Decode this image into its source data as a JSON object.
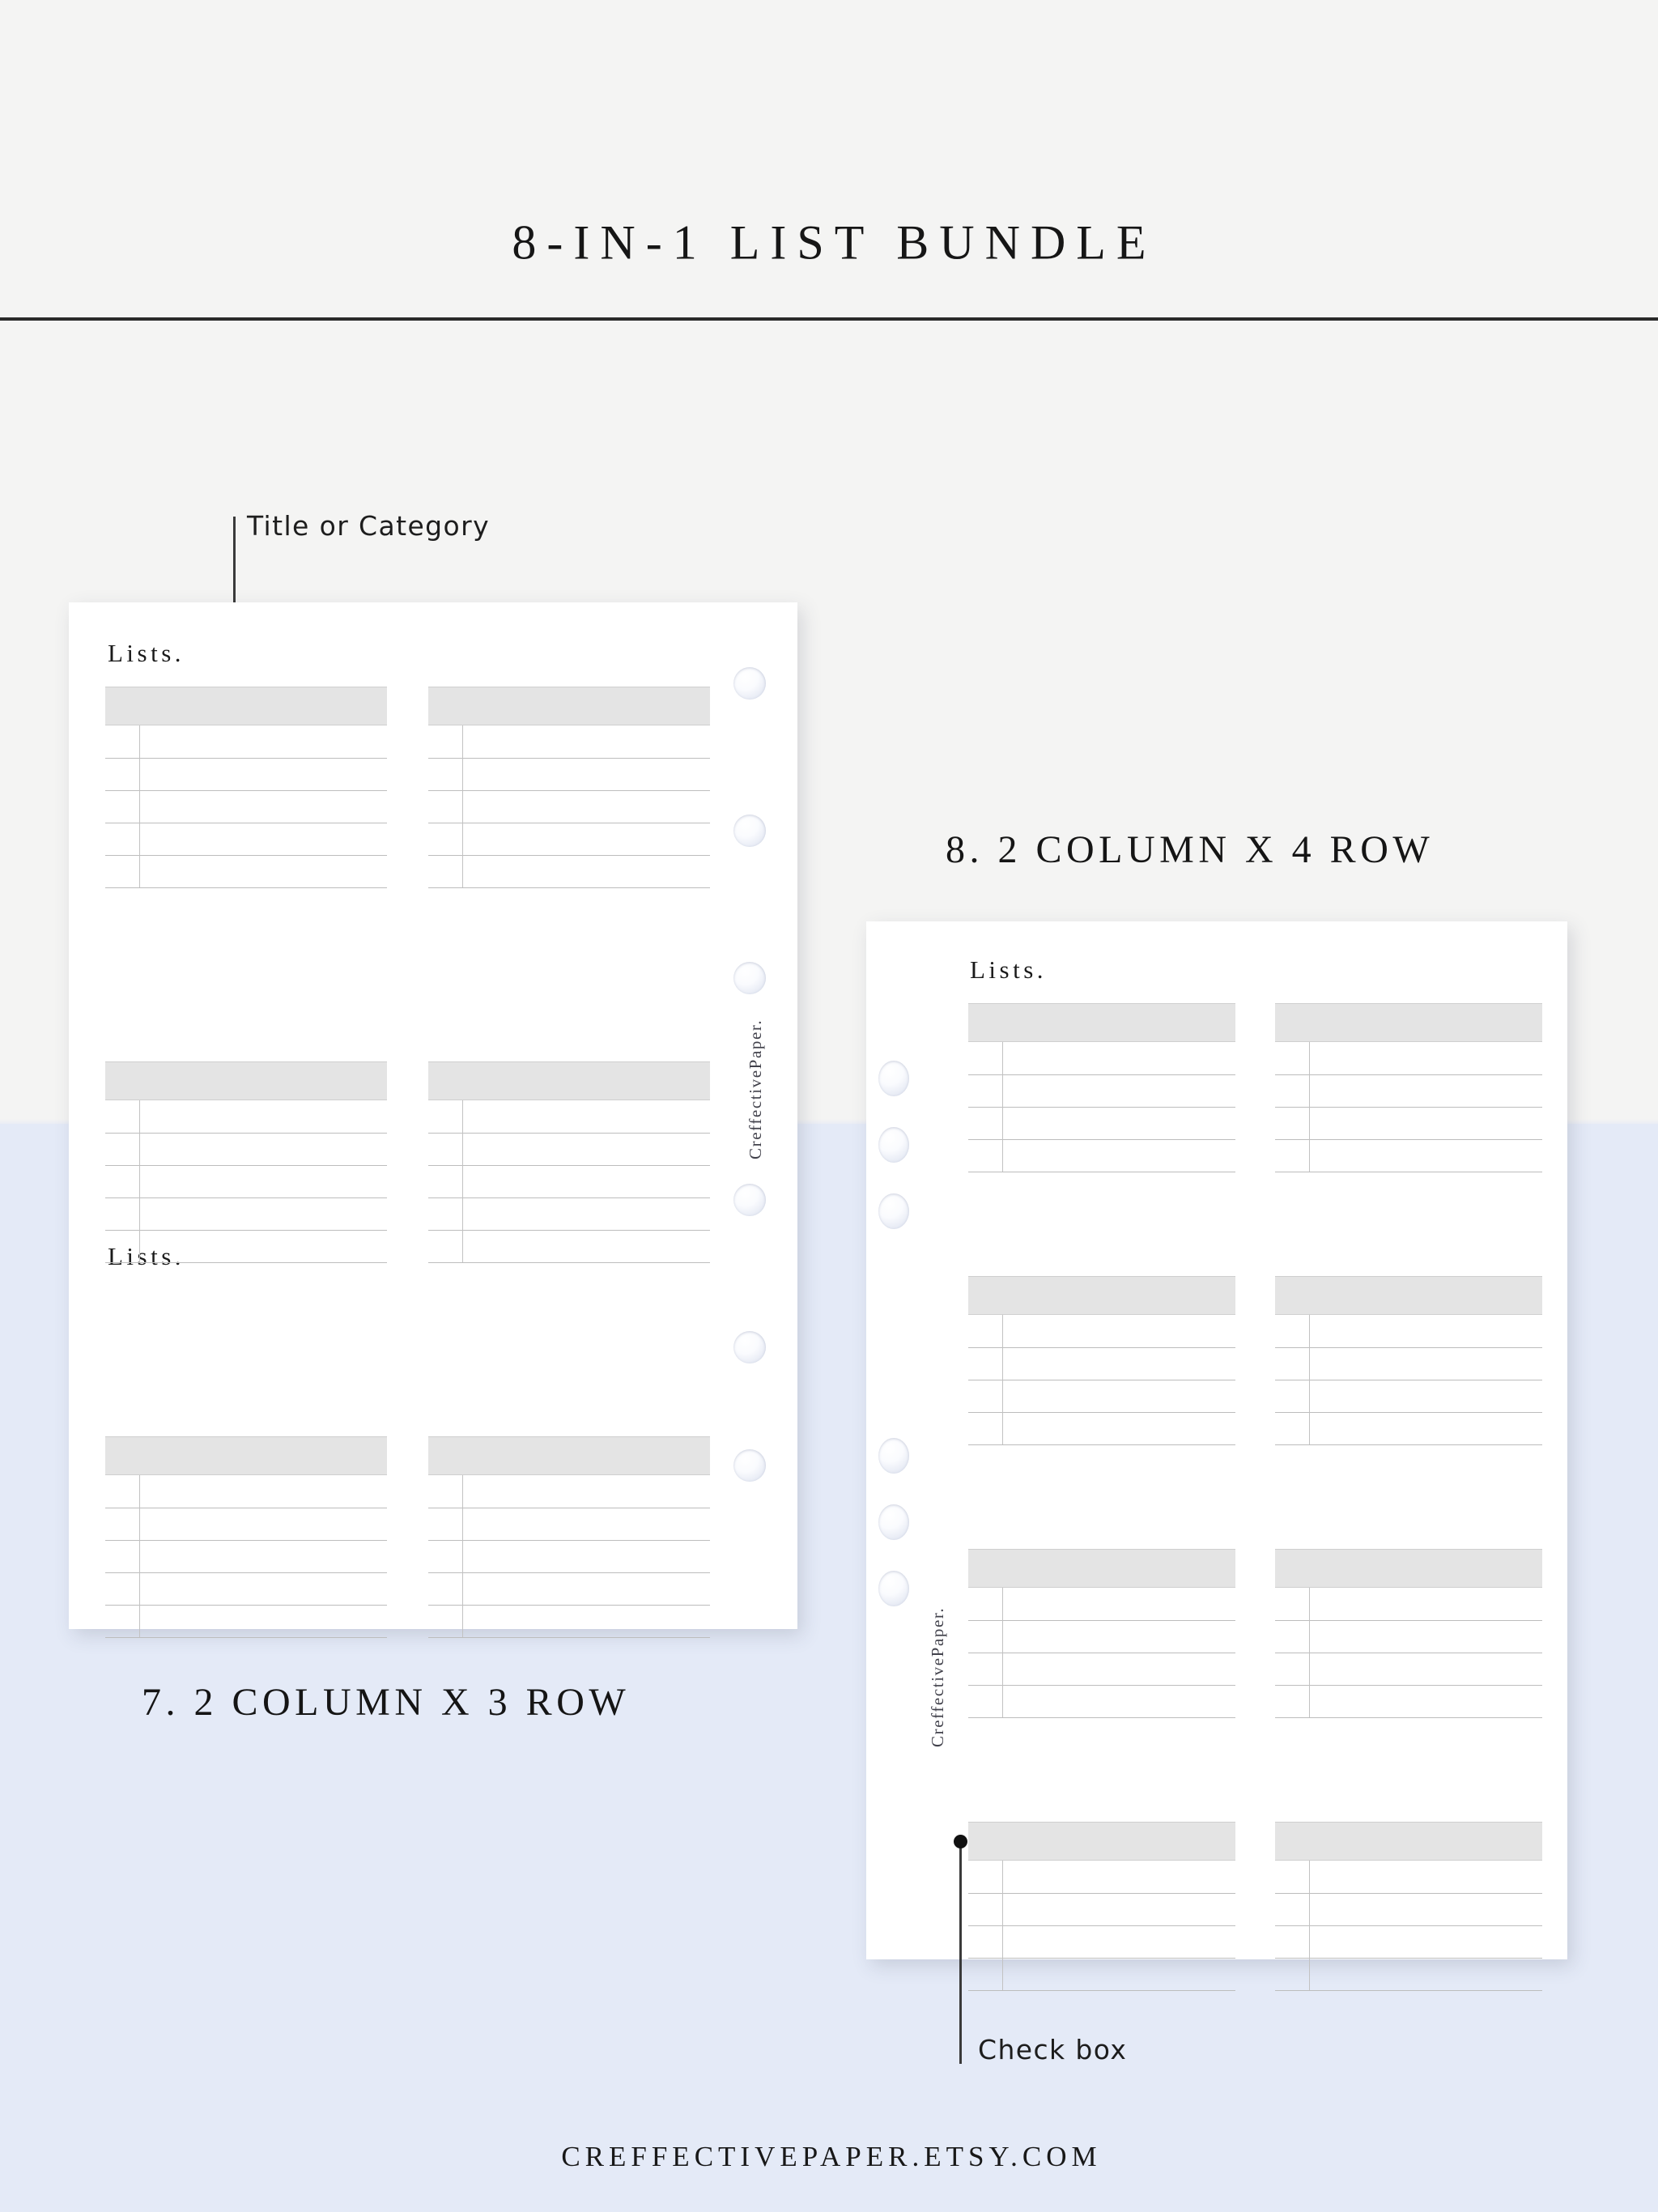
{
  "header": {
    "title": "8-IN-1 LIST BUNDLE"
  },
  "annotations": {
    "title_or_category": "Title or Category",
    "check_box": "Check box"
  },
  "captions": {
    "card_left": "7. 2 COLUMN X 3 ROW",
    "card_right": "8. 2 COLUMN X 4 ROW"
  },
  "cards": [
    {
      "id": "card-7",
      "heading": "Lists.",
      "watermark": "CreffectivePaper.",
      "layout": "2 column x 3 row",
      "columns": 2,
      "rows": 3,
      "lines_per_block": 5,
      "holes": 6,
      "holes_side": "right"
    },
    {
      "id": "card-8",
      "heading": "Lists.",
      "watermark": "CreffectivePaper.",
      "layout": "2 column x 4 row",
      "columns": 2,
      "rows": 4,
      "lines_per_block": 4,
      "holes": 6,
      "holes_side": "left"
    }
  ],
  "footer": {
    "url": "CREFFECTIVEPAPER.ETSY.COM"
  },
  "colors": {
    "page_bg_top": "#f4f4f3",
    "page_bg_bottom": "#e4eaf7",
    "card_bg": "#ffffff",
    "block_header": "#e4e4e4",
    "rule_line": "#bdbdbd",
    "title_text": "#161616"
  }
}
